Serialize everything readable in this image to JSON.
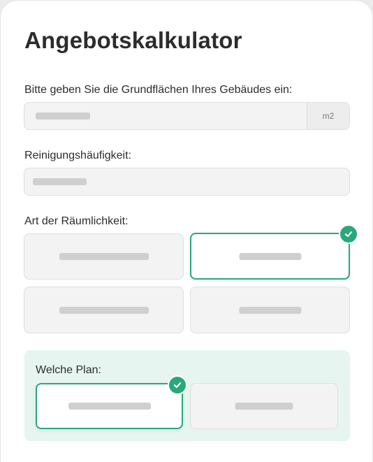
{
  "title": "Angebotskalkulator",
  "area": {
    "label": "Bitte geben Sie die Grundflächen Ihres Gebäudes ein:",
    "unit": "m2"
  },
  "frequency": {
    "label": "Reinigungshäufigkeit:"
  },
  "room_type": {
    "label": "Art der Räumlichkeit:",
    "options": [
      {
        "selected": false
      },
      {
        "selected": true
      },
      {
        "selected": false
      },
      {
        "selected": false
      }
    ]
  },
  "plan": {
    "label": "Welche Plan:",
    "options": [
      {
        "selected": true
      },
      {
        "selected": false
      }
    ]
  },
  "colors": {
    "accent": "#2aa87a",
    "panel_background": "#e6f5ef",
    "field_background": "#f3f3f4"
  },
  "icons": {
    "selected_badge": "check-circle-icon"
  }
}
